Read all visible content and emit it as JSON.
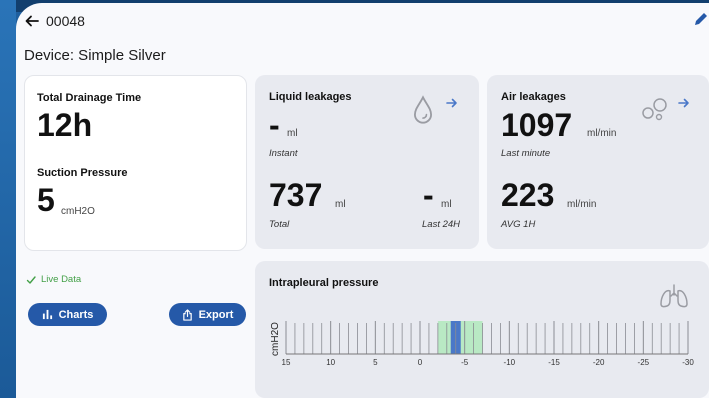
{
  "header": {
    "code": "00048"
  },
  "device": {
    "label": "Device: Simple Silver"
  },
  "drainage": {
    "total_time_label": "Total Drainage Time",
    "total_time_value": "12h",
    "suction_label": "Suction Pressure",
    "suction_value": "5",
    "suction_unit": "cmH2O"
  },
  "liquid": {
    "title": "Liquid leakages",
    "instant_value": "-",
    "instant_unit": "ml",
    "instant_label": "Instant",
    "total_value": "737",
    "total_unit": "ml",
    "total_label": "Total",
    "last24_value": "-",
    "last24_unit": "ml",
    "last24_label": "Last 24H"
  },
  "air": {
    "title": "Air leakages",
    "minute_value": "1097",
    "minute_unit": "ml/min",
    "minute_label": "Last minute",
    "avg_value": "223",
    "avg_unit": "ml/min",
    "avg_label": "AVG 1H"
  },
  "status": {
    "live_label": "Live Data"
  },
  "actions": {
    "charts_label": "Charts",
    "export_label": "Export"
  },
  "intrapleural": {
    "title": "Intrapleural pressure",
    "axis_unit": "cmH2O",
    "range_min": -30,
    "range_max": 15,
    "tick_labels": [
      "15",
      "10",
      "5",
      "0",
      "-5",
      "-10",
      "-15",
      "-20",
      "-25",
      "-30"
    ],
    "green_band": [
      -2,
      -7
    ],
    "current_value": -4
  },
  "colors": {
    "primary": "#2559a8",
    "accent_blue": "#4a78c8",
    "band_green": "#b9e9c4",
    "live_green": "#43a047"
  },
  "icons": {
    "back": "arrow-left-icon",
    "edit": "pencil-icon",
    "drop": "water-drop-icon",
    "bubbles": "bubbles-icon",
    "lungs": "lungs-icon",
    "chart": "bar-chart-icon",
    "export": "share-icon",
    "check": "check-icon"
  }
}
